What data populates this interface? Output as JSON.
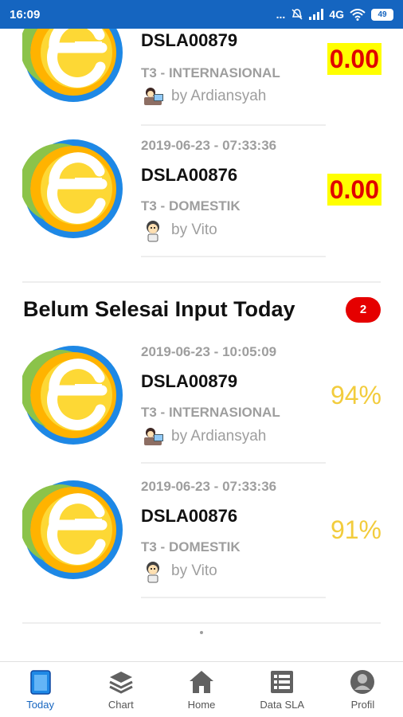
{
  "status_bar": {
    "time": "16:09",
    "dots": "...",
    "network": "4G",
    "battery": "49",
    "icons": [
      "silent-icon",
      "signal-icon",
      "wifi-icon",
      "battery-icon"
    ]
  },
  "colors": {
    "accent": "#1565c0",
    "badge_red": "#e50000",
    "value_highlight": "#ffff00",
    "value_text": "#e00000",
    "percent": "#f2cc3d"
  },
  "top_list": [
    {
      "code": "DSLA00879",
      "category": "T3 - INTERNASIONAL",
      "by": "by Ardiansyah",
      "value": "0.00"
    },
    {
      "time": "2019-06-23 - 07:33:36",
      "code": "DSLA00876",
      "category": "T3 - DOMESTIK",
      "by": "by Vito",
      "value": "0.00"
    }
  ],
  "section": {
    "title": "Belum Selesai Input Today",
    "count": "2"
  },
  "pending_list": [
    {
      "time": "2019-06-23 - 10:05:09",
      "code": "DSLA00879",
      "category": "T3 - INTERNASIONAL",
      "by": "by Ardiansyah",
      "value": "94%"
    },
    {
      "time": "2019-06-23 - 07:33:36",
      "code": "DSLA00876",
      "category": "T3 - DOMESTIK",
      "by": "by Vito",
      "value": "91%"
    }
  ],
  "nav": [
    {
      "label": "Today",
      "icon": "today-icon",
      "active": true
    },
    {
      "label": "Chart",
      "icon": "layers-icon"
    },
    {
      "label": "Home",
      "icon": "home-icon"
    },
    {
      "label": "Data SLA",
      "icon": "list-icon"
    },
    {
      "label": "Profil",
      "icon": "profile-icon"
    }
  ]
}
